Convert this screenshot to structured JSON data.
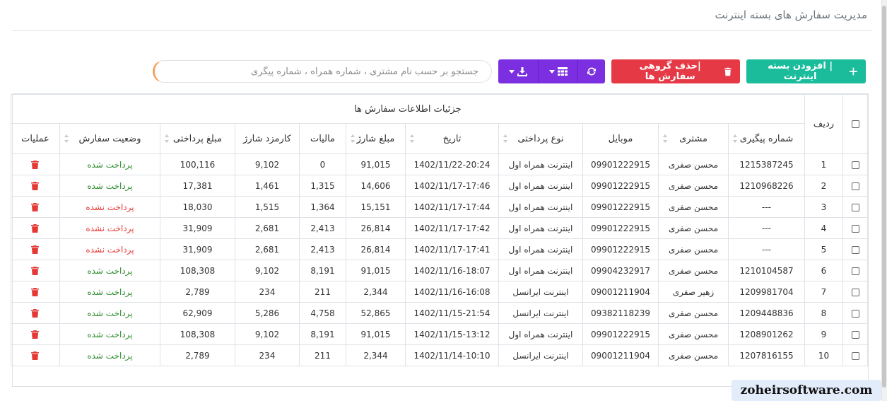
{
  "page": {
    "title": "مدیریت سفارش های بسته اینترنت"
  },
  "toolbar": {
    "add_label": "| افزودن بسته اینترنت",
    "delete_label": "|حذف گروهی سفارش ها",
    "search_placeholder": "جستجو بر حسب نام مشتری ، شماره همراه ، شماره پیگری",
    "icons": [
      "plus-icon",
      "trash-icon",
      "refresh-icon",
      "columns-icon",
      "download-icon",
      "caret-down-icon"
    ],
    "colors": {
      "add": "#1abc9c",
      "delete": "#e63946",
      "purple": "#7b2fe0",
      "search_accent": "#f5a25d"
    }
  },
  "table": {
    "group_header": "جزئیات اطلاعات سفارش ها",
    "row_header": "ردیف",
    "columns": [
      "شماره پیگیری",
      "مشتری",
      "موبایل",
      "نوع پرداختی",
      "تاریخ",
      "مبلغ شارژ",
      "مالیات",
      "کارمزد شارژ",
      "مبلغ پرداختی",
      "وضعیت سفارش",
      "عملیات"
    ],
    "rows": [
      {
        "n": "1",
        "tracking": "1215387245",
        "customer": "محسن صفری",
        "mobile": "09901222915",
        "payment_type": "اینترنت همراه اول",
        "date": "1402/11/22-20:24",
        "charge": "91,015",
        "tax": "0",
        "fee": "9,102",
        "paid": "100,116",
        "status": "پرداخت شده",
        "status_ok": true
      },
      {
        "n": "2",
        "tracking": "1210968226",
        "customer": "محسن صفری",
        "mobile": "09901222915",
        "payment_type": "اینترنت همراه اول",
        "date": "1402/11/17-17:46",
        "charge": "14,606",
        "tax": "1,315",
        "fee": "1,461",
        "paid": "17,381",
        "status": "پرداخت شده",
        "status_ok": true
      },
      {
        "n": "3",
        "tracking": "---",
        "customer": "محسن صفری",
        "mobile": "09901222915",
        "payment_type": "اینترنت همراه اول",
        "date": "1402/11/17-17:44",
        "charge": "15,151",
        "tax": "1,364",
        "fee": "1,515",
        "paid": "18,030",
        "status": "پرداخت نشده",
        "status_ok": false
      },
      {
        "n": "4",
        "tracking": "---",
        "customer": "محسن صفری",
        "mobile": "09901222915",
        "payment_type": "اینترنت همراه اول",
        "date": "1402/11/17-17:42",
        "charge": "26,814",
        "tax": "2,413",
        "fee": "2,681",
        "paid": "31,909",
        "status": "پرداخت نشده",
        "status_ok": false
      },
      {
        "n": "5",
        "tracking": "---",
        "customer": "محسن صفری",
        "mobile": "09901222915",
        "payment_type": "اینترنت همراه اول",
        "date": "1402/11/17-17:41",
        "charge": "26,814",
        "tax": "2,413",
        "fee": "2,681",
        "paid": "31,909",
        "status": "پرداخت نشده",
        "status_ok": false
      },
      {
        "n": "6",
        "tracking": "1210104587",
        "customer": "محسن صفری",
        "mobile": "09904232917",
        "payment_type": "اینترنت همراه اول",
        "date": "1402/11/16-18:07",
        "charge": "91,015",
        "tax": "8,191",
        "fee": "9,102",
        "paid": "108,308",
        "status": "پرداخت شده",
        "status_ok": true
      },
      {
        "n": "7",
        "tracking": "1209981704",
        "customer": "زهیر صفری",
        "mobile": "09001211904",
        "payment_type": "اینترنت ایرانسل",
        "date": "1402/11/16-16:08",
        "charge": "2,344",
        "tax": "211",
        "fee": "234",
        "paid": "2,789",
        "status": "پرداخت شده",
        "status_ok": true
      },
      {
        "n": "8",
        "tracking": "1209448836",
        "customer": "محسن صفری",
        "mobile": "09382118239",
        "payment_type": "اینترنت ایرانسل",
        "date": "1402/11/15-21:54",
        "charge": "52,865",
        "tax": "4,758",
        "fee": "5,286",
        "paid": "62,909",
        "status": "پرداخت شده",
        "status_ok": true
      },
      {
        "n": "9",
        "tracking": "1208901262",
        "customer": "محسن صفری",
        "mobile": "09901222915",
        "payment_type": "اینترنت همراه اول",
        "date": "1402/11/15-13:12",
        "charge": "91,015",
        "tax": "8,191",
        "fee": "9,102",
        "paid": "108,308",
        "status": "پرداخت شده",
        "status_ok": true
      },
      {
        "n": "10",
        "tracking": "1207816155",
        "customer": "محسن صفری",
        "mobile": "09001211904",
        "payment_type": "اینترنت ایرانسل",
        "date": "1402/11/14-10:10",
        "charge": "2,344",
        "tax": "211",
        "fee": "234",
        "paid": "2,789",
        "status": "پرداخت شده",
        "status_ok": true
      }
    ],
    "colors": {
      "paid": "#2e8b2e",
      "unpaid": "#e53935",
      "trash": "#e53935"
    }
  },
  "watermark": "zoheirsoftware.com"
}
